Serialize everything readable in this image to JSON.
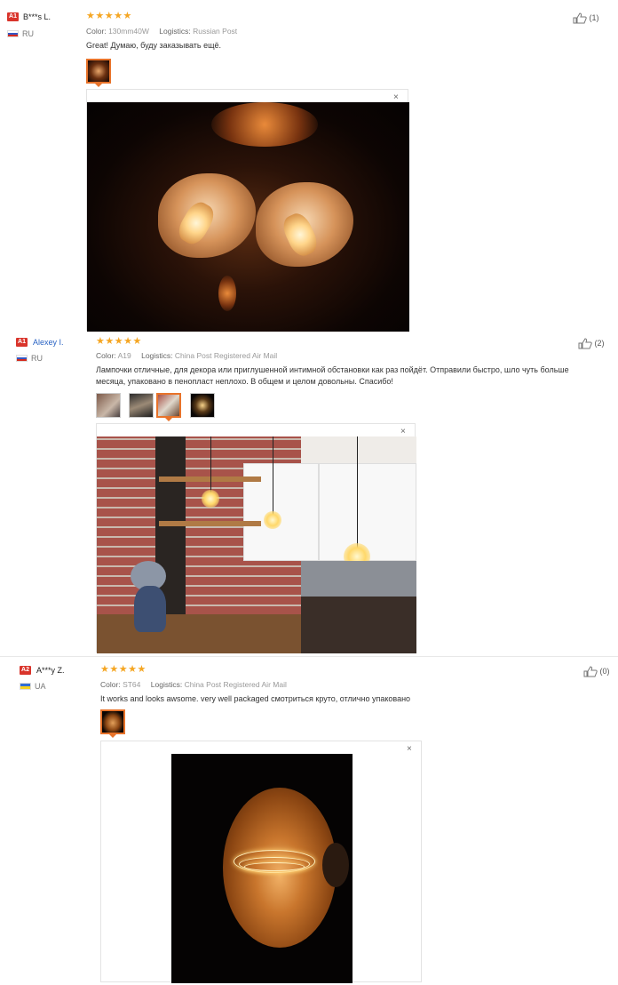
{
  "reviews": [
    {
      "badge": "A1",
      "user": "B***s L.",
      "country": "RU",
      "stars": "★★★★★",
      "color_label": "Color:",
      "color_value": "130mm40W",
      "logistics_label": "Logistics:",
      "logistics_value": "Russian Post",
      "text": "Great! Думаю, буду заказывать ещё.",
      "helpful_count": "(1)",
      "close": "×"
    },
    {
      "badge": "A1",
      "user": "Alexey I.",
      "country": "RU",
      "stars": "★★★★★",
      "color_label": "Color:",
      "color_value": "A19",
      "logistics_label": "Logistics:",
      "logistics_value": "China Post Registered Air Mail",
      "text": "Лампочки отличные, для декора или приглушенной интимной обстановки как раз пойдёт. Отправили быстро, шло чуть больше месяца, упаковано в пенопласт неплохо. В общем и целом довольны. Спасибо!",
      "helpful_count": "(2)",
      "close": "×"
    },
    {
      "badge": "A2",
      "user": "A***y Z.",
      "country": "UA",
      "stars": "★★★★★",
      "color_label": "Color:",
      "color_value": "ST64",
      "logistics_label": "Logistics:",
      "logistics_value": "China Post Registered Air Mail",
      "text": "It works and looks awsome. very well packaged смотриться круто, отлично упаковано",
      "helpful_count": "(0)",
      "close": "×"
    }
  ],
  "colors": {
    "star": "#f5a623",
    "badge": "#d9342b",
    "link": "#2a64c4",
    "thumb_active": "#e8732a"
  },
  "icons": {
    "helpful": "thumbs-up-icon",
    "close": "close-icon"
  }
}
